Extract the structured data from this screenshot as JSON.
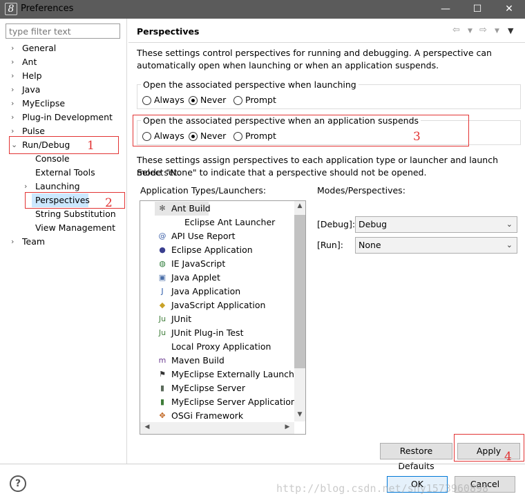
{
  "window": {
    "title": "Preferences",
    "app_icon_glyph": "8",
    "controls": {
      "minimize": "—",
      "maximize": "☐",
      "close": "✕"
    }
  },
  "filter": {
    "placeholder": "type filter text"
  },
  "tree": {
    "items": [
      {
        "label": "General",
        "expanded": false,
        "level": 0
      },
      {
        "label": "Ant",
        "expanded": false,
        "level": 0
      },
      {
        "label": "Help",
        "expanded": false,
        "level": 0
      },
      {
        "label": "Java",
        "expanded": false,
        "level": 0
      },
      {
        "label": "MyEclipse",
        "expanded": false,
        "level": 0
      },
      {
        "label": "Plug-in Development",
        "expanded": false,
        "level": 0
      },
      {
        "label": "Pulse",
        "expanded": false,
        "level": 0
      },
      {
        "label": "Run/Debug",
        "expanded": true,
        "level": 0
      },
      {
        "label": "Console",
        "level": 1
      },
      {
        "label": "External Tools",
        "level": 1
      },
      {
        "label": "Launching",
        "expanded": false,
        "level": 1
      },
      {
        "label": "Perspectives",
        "level": 1,
        "selected": true
      },
      {
        "label": "String Substitution",
        "level": 1
      },
      {
        "label": "View Management",
        "level": 1
      },
      {
        "label": "Team",
        "expanded": false,
        "level": 0
      }
    ]
  },
  "page": {
    "title": "Perspectives",
    "intro_line1": "These settings control perspectives for running and debugging. A perspective can",
    "intro_line2": "automatically open when launching or when an application suspends.",
    "group_launch": {
      "label": "Open the associated perspective when launching",
      "options": [
        "Always",
        "Never",
        "Prompt"
      ],
      "selected": "Never"
    },
    "group_suspend": {
      "label": "Open the associated perspective when an application suspends",
      "options": [
        "Always",
        "Never",
        "Prompt"
      ],
      "selected": "Never"
    },
    "assign_line1": "These settings assign perspectives to each application type or launcher and launch mode set.",
    "assign_line2": "Select \"None\" to indicate that a perspective should not be opened.",
    "app_types_label": "Application Types/Launchers:",
    "modes_label": "Modes/Perspectives:",
    "launchers": [
      {
        "label": "Ant Build",
        "icon": "ant-icon",
        "glyph": "✻",
        "color": "#555555",
        "selected": true
      },
      {
        "label": "Eclipse Ant Launcher",
        "icon": "",
        "glyph": "",
        "color": "",
        "indent": true
      },
      {
        "label": "API Use Report",
        "icon": "api-report-icon",
        "glyph": "@",
        "color": "#3b5fa8"
      },
      {
        "label": "Eclipse Application",
        "icon": "eclipse-icon",
        "glyph": "●",
        "color": "#3a3f8f"
      },
      {
        "label": "IE JavaScript",
        "icon": "globe-icon",
        "glyph": "◍",
        "color": "#2f7d3a"
      },
      {
        "label": "Java Applet",
        "icon": "applet-icon",
        "glyph": "▣",
        "color": "#4b6fa8"
      },
      {
        "label": "Java Application",
        "icon": "java-app-icon",
        "glyph": "J",
        "color": "#2b5aa8"
      },
      {
        "label": "JavaScript Application",
        "icon": "js-app-icon",
        "glyph": "◆",
        "color": "#c9a227"
      },
      {
        "label": "JUnit",
        "icon": "junit-icon",
        "glyph": "Ju",
        "color": "#3f7d3a"
      },
      {
        "label": "JUnit Plug-in Test",
        "icon": "junit-plugin-icon",
        "glyph": "Ju",
        "color": "#3f7d3a"
      },
      {
        "label": "Local Proxy Application",
        "icon": "",
        "glyph": "",
        "color": ""
      },
      {
        "label": "Maven Build",
        "icon": "maven-icon",
        "glyph": "m",
        "color": "#6a3a8f"
      },
      {
        "label": "MyEclipse Externally Launched",
        "icon": "external-launch-icon",
        "glyph": "⚑",
        "color": "#333333"
      },
      {
        "label": "MyEclipse Server",
        "icon": "server-icon",
        "glyph": "▮",
        "color": "#5b6b5b"
      },
      {
        "label": "MyEclipse Server Application",
        "icon": "server-app-icon",
        "glyph": "▮",
        "color": "#3f7d3a"
      },
      {
        "label": "OSGi Framework",
        "icon": "osgi-icon",
        "glyph": "✥",
        "color": "#c0641f"
      }
    ],
    "debug_label": "[Debug]:",
    "debug_value": "Debug",
    "run_label": "[Run]:",
    "run_value": "None",
    "restore_defaults": "Restore Defaults",
    "apply": "Apply"
  },
  "buttons": {
    "ok": "OK",
    "cancel": "Cancel"
  },
  "annotations": {
    "n1": "1",
    "n2": "2",
    "n3": "3",
    "n4": "4"
  },
  "watermark": "http://blog.csdn.net/shy1573960898"
}
